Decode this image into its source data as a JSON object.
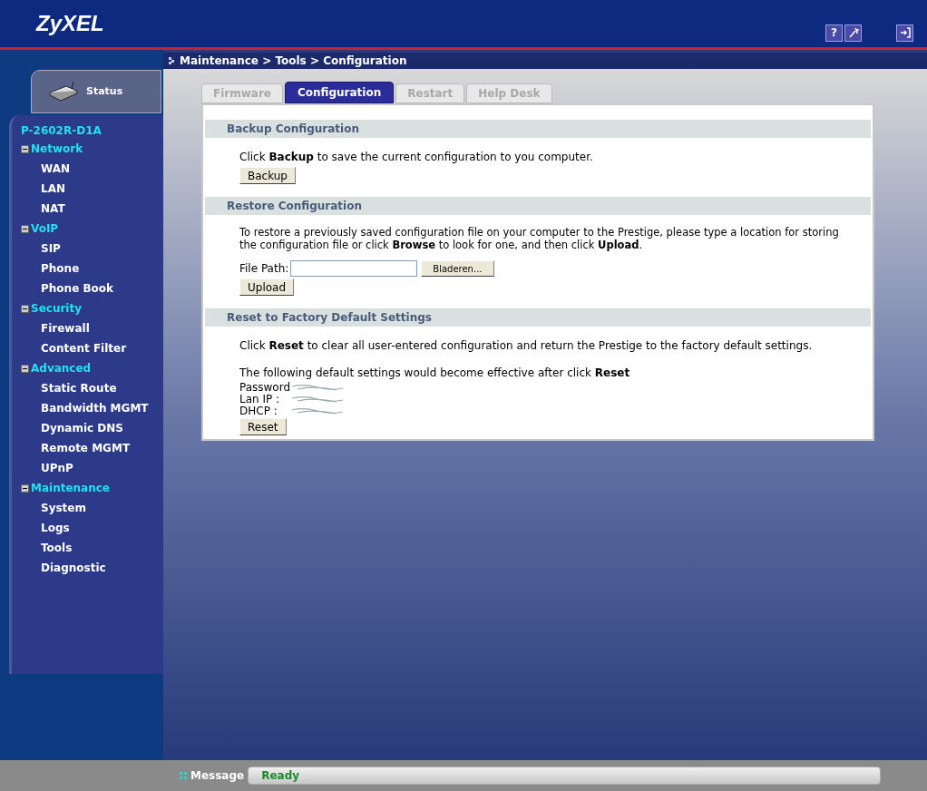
{
  "header": {
    "logo": "ZyXEL",
    "help": "?"
  },
  "breadcrumb": "Maintenance > Tools > Configuration",
  "sidebar": {
    "status_tab": "Status",
    "device": "P-2602R-D1A",
    "tree": [
      {
        "label": "Network",
        "expanded": true,
        "children": [
          {
            "label": "WAN"
          },
          {
            "label": "LAN"
          },
          {
            "label": "NAT"
          }
        ]
      },
      {
        "label": "VoIP",
        "expanded": true,
        "children": [
          {
            "label": "SIP"
          },
          {
            "label": "Phone"
          },
          {
            "label": "Phone Book"
          }
        ]
      },
      {
        "label": "Security",
        "expanded": true,
        "children": [
          {
            "label": "Firewall"
          },
          {
            "label": "Content Filter"
          }
        ]
      },
      {
        "label": "Advanced",
        "expanded": true,
        "children": [
          {
            "label": "Static Route"
          },
          {
            "label": "Bandwidth MGMT"
          },
          {
            "label": "Dynamic DNS"
          },
          {
            "label": "Remote MGMT"
          },
          {
            "label": "UPnP"
          }
        ]
      },
      {
        "label": "Maintenance",
        "expanded": true,
        "children": [
          {
            "label": "System"
          },
          {
            "label": "Logs"
          },
          {
            "label": "Tools"
          },
          {
            "label": "Diagnostic"
          }
        ]
      }
    ]
  },
  "tabs": [
    {
      "label": "Firmware",
      "selected": false
    },
    {
      "label": "Configuration",
      "selected": true
    },
    {
      "label": "Restart",
      "selected": false
    },
    {
      "label": "Help Desk",
      "selected": false
    }
  ],
  "backup": {
    "title": "Backup Configuration",
    "text": "Click **Backup** to save the current configuration to you computer.",
    "button": "Backup"
  },
  "restore": {
    "title": "Restore Configuration",
    "text": "To restore a previously saved configuration file on your computer to the Prestige, please type a location for storing the configuration file or click **Browse** to look for one, and then click **Upload**.",
    "file_label": "File Path:",
    "browse_button": "Bladeren...",
    "button": "Upload"
  },
  "reset": {
    "title": "Reset to Factory Default Settings",
    "text": "Click **Reset** to clear all user-entered configuration and return the Prestige to the factory default settings.",
    "defaults_text": "The following default settings would become effective after click **Reset**",
    "settings": [
      {
        "label": "Password"
      },
      {
        "label": "Lan IP :"
      },
      {
        "label": "DHCP :"
      }
    ],
    "button": "Reset"
  },
  "status_bar": {
    "label": "Message",
    "value": "Ready"
  }
}
